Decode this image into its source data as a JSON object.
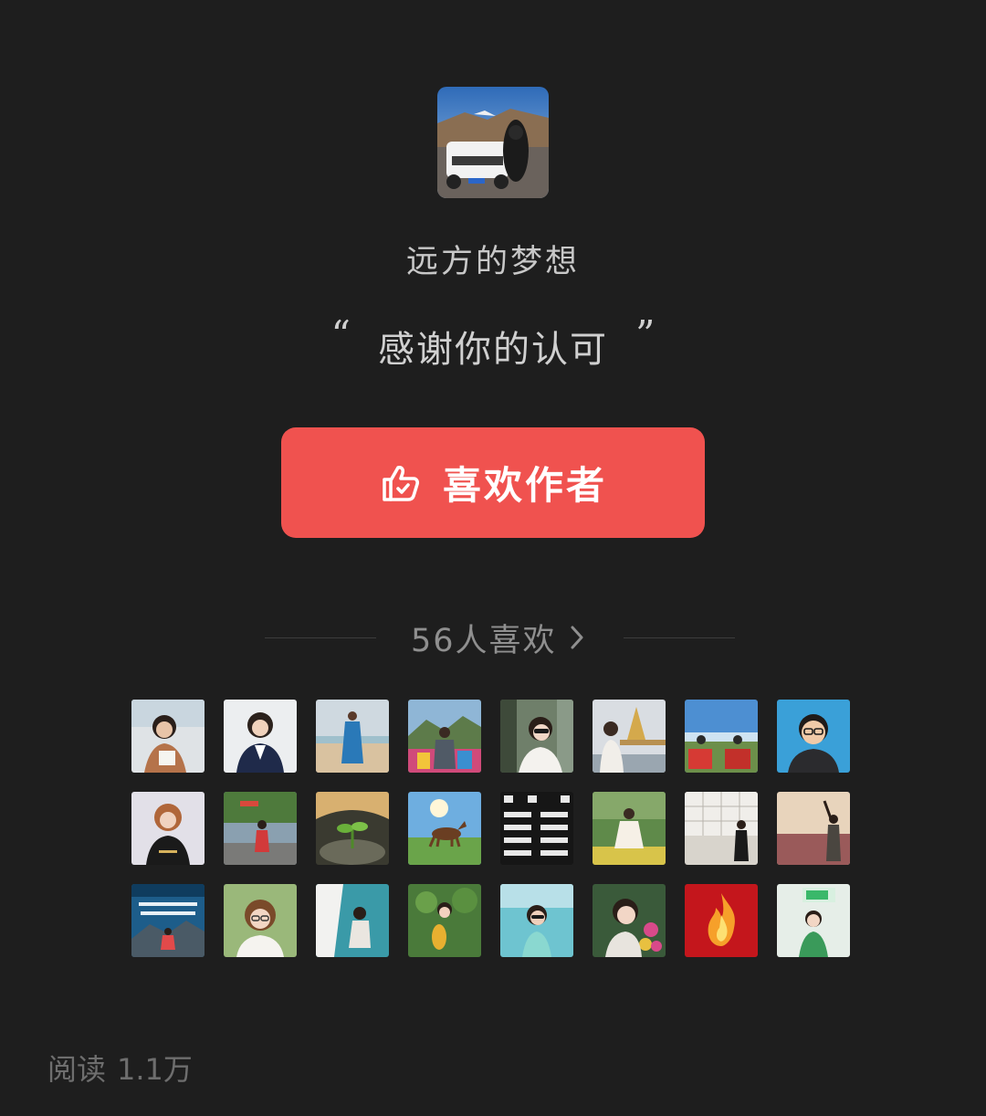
{
  "author": {
    "avatar_description": "photo",
    "name": "远方的梦想"
  },
  "message": {
    "open_quote": "“",
    "text": "感谢你的认可",
    "close_quote": "”"
  },
  "like_button": {
    "icon": "thumbs-up-icon",
    "label": "喜欢作者",
    "color": "#f0524f"
  },
  "likers": {
    "count_label": "56人喜欢",
    "chevron_icon": "chevron-right-icon",
    "avatar_count_visible": 24
  },
  "read_stat": {
    "label": "阅读",
    "value": "1.1万"
  },
  "colors": {
    "background": "#1e1e1e",
    "accent": "#f0524f"
  }
}
